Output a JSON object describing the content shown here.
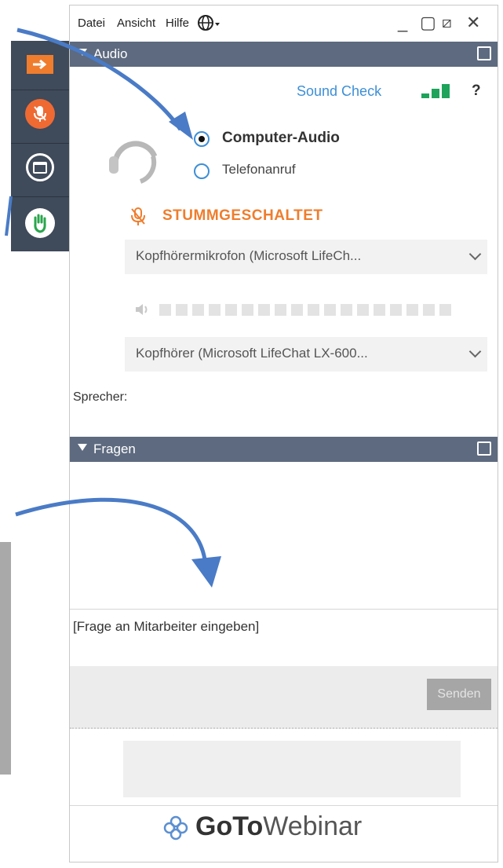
{
  "menu": {
    "items": [
      "Datei",
      "Ansicht",
      "Hilfe"
    ],
    "language_icon": "globe-icon"
  },
  "window_controls": {
    "minimize": "_",
    "maximize": "▢",
    "restore": "⧄",
    "close": "✕"
  },
  "audio": {
    "section_title": "Audio",
    "sound_check_label": "Sound Check",
    "help_label": "?",
    "options": [
      "Computer-Audio",
      "Telefonanruf"
    ],
    "selected_option": "Computer-Audio",
    "mute_status": "STUMMGESCHALTET",
    "microphone_device": "Kopfhörermikrofon (Microsoft LifeCh...",
    "speaker_device": "Kopfhörer (Microsoft LifeChat LX-600...",
    "speaker_label": "Sprecher:"
  },
  "questions": {
    "section_title": "Fragen",
    "input_placeholder": "[Frage an Mitarbeiter eingeben]",
    "send_label": "Senden"
  },
  "brand": {
    "go": "GoTo",
    "webinar": "Webinar"
  },
  "colors": {
    "accent_orange": "#ef7d2d",
    "sound_check_blue": "#3d8fd6",
    "signal_green": "#1da35a",
    "header_slate": "#5d6a7f",
    "toolbar_dark": "#3f4a5a",
    "arrow_blue": "#4a7bc6"
  }
}
